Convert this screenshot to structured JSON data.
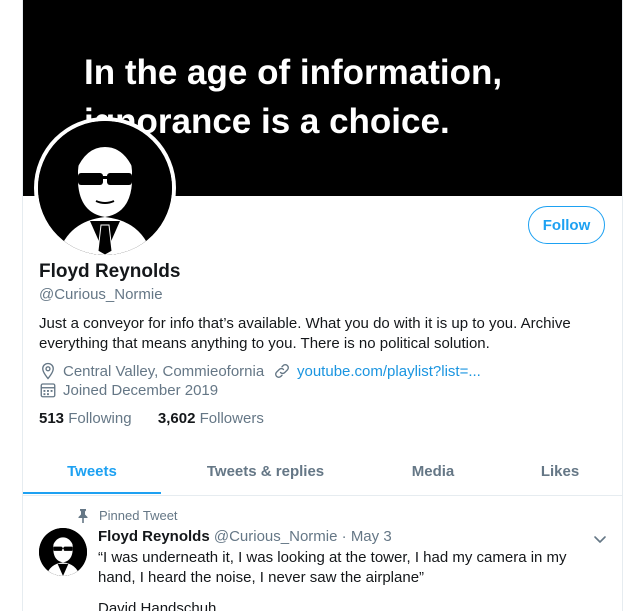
{
  "banner": {
    "line1": "In the age of information,",
    "line2": "ignorance is a choice."
  },
  "profile": {
    "name": "Floyd Reynolds",
    "handle": "@Curious_Normie",
    "bio": "Just a conveyor for info that’s available. What you do with it is up to you. Archive everything that means anything to you. There is no political solution.",
    "location": "Central Valley, Commieofornia",
    "website": "youtube.com/playlist?list=...",
    "joined": "Joined December 2019",
    "following_count": "513",
    "following_label": "Following",
    "followers_count": "3,602",
    "followers_label": "Followers",
    "follow_button": "Follow"
  },
  "tabs": [
    {
      "label": "Tweets",
      "active": true
    },
    {
      "label": "Tweets & replies",
      "active": false
    },
    {
      "label": "Media",
      "active": false
    },
    {
      "label": "Likes",
      "active": false
    }
  ],
  "pinned_tweet": {
    "pinned_label": "Pinned Tweet",
    "author_name": "Floyd Reynolds",
    "author_handle": "@Curious_Normie",
    "separator": "·",
    "date": "May 3",
    "text": "“I was underneath it, I was looking at the tower, I had my camera in my hand, I heard the noise, I never saw the airplane”",
    "text_cont": "David Handschuh"
  },
  "icons": {
    "location": "location-pin-icon",
    "link": "link-icon",
    "calendar": "calendar-icon",
    "pin": "pin-icon",
    "caret": "chevron-down-icon"
  },
  "colors": {
    "accent": "#1da1f2",
    "link": "#1b95e0",
    "secondary_text": "#657786",
    "primary_text": "#14171a"
  }
}
